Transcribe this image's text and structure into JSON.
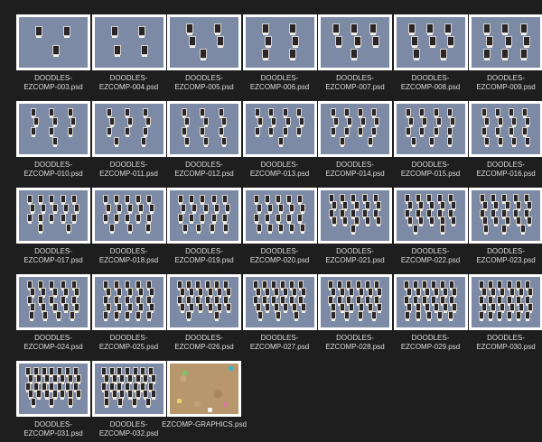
{
  "files": [
    {
      "name": "DOODLES-\nEZCOMP-003.psd",
      "photos": 3
    },
    {
      "name": "DOODLES-\nEZCOMP-004.psd",
      "photos": 4
    },
    {
      "name": "DOODLES-\nEZCOMP-005.psd",
      "photos": 5
    },
    {
      "name": "DOODLES-\nEZCOMP-006.psd",
      "photos": 6
    },
    {
      "name": "DOODLES-\nEZCOMP-007.psd",
      "photos": 7
    },
    {
      "name": "DOODLES-\nEZCOMP-008.psd",
      "photos": 8
    },
    {
      "name": "DOODLES-\nEZCOMP-009.psd",
      "photos": 9
    },
    {
      "name": "DOODLES-\nEZCOMP-010.psd",
      "photos": 10
    },
    {
      "name": "DOODLES-\nEZCOMP-011.psd",
      "photos": 11
    },
    {
      "name": "DOODLES-\nEZCOMP-012.psd",
      "photos": 12
    },
    {
      "name": "DOODLES-\nEZCOMP-013.psd",
      "photos": 13
    },
    {
      "name": "DOODLES-\nEZCOMP-014.psd",
      "photos": 14
    },
    {
      "name": "DOODLES-\nEZCOMP-015.psd",
      "photos": 15
    },
    {
      "name": "DOODLES-\nEZCOMP-016.psd",
      "photos": 16
    },
    {
      "name": "DOODLES-\nEZCOMP-017.psd",
      "photos": 17
    },
    {
      "name": "DOODLES-\nEZCOMP-018.psd",
      "photos": 18
    },
    {
      "name": "DOODLES-\nEZCOMP-019.psd",
      "photos": 19
    },
    {
      "name": "DOODLES-\nEZCOMP-020.psd",
      "photos": 20
    },
    {
      "name": "DOODLES-\nEZCOMP-021.psd",
      "photos": 21
    },
    {
      "name": "DOODLES-\nEZCOMP-022.psd",
      "photos": 22
    },
    {
      "name": "DOODLES-\nEZCOMP-023.psd",
      "photos": 23
    },
    {
      "name": "DOODLES-\nEZCOMP-024.psd",
      "photos": 24
    },
    {
      "name": "DOODLES-\nEZCOMP-025.psd",
      "photos": 25
    },
    {
      "name": "DOODLES-\nEZCOMP-026.psd",
      "photos": 26
    },
    {
      "name": "DOODLES-\nEZCOMP-027.psd",
      "photos": 27
    },
    {
      "name": "DOODLES-\nEZCOMP-028.psd",
      "photos": 28
    },
    {
      "name": "DOODLES-\nEZCOMP-029.psd",
      "photos": 29
    },
    {
      "name": "DOODLES-\nEZCOMP-030.psd",
      "photos": 30
    },
    {
      "name": "DOODLES-\nEZCOMP-031.psd",
      "photos": 31
    },
    {
      "name": "DOODLES-\nEZCOMP-032.psd",
      "photos": 32
    },
    {
      "name": "EZCOMP-GRAPHICS.psd",
      "photos": 0,
      "graphics": true
    }
  ],
  "colors": {
    "background": "#1e1e1e",
    "thumb_frame": "#ffffff",
    "comp_background": "#7c8aa6",
    "graphics_background": "#b9976d",
    "label_text": "#dcdcdc"
  }
}
